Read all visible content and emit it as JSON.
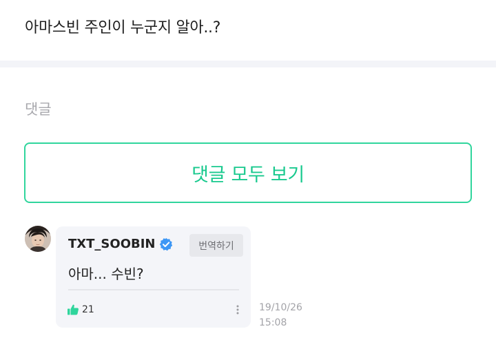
{
  "post": {
    "text": "아마스빈 주인이 누군지 알아..?"
  },
  "comments_section": {
    "heading": "댓글",
    "view_all_label": "댓글 모두 보기"
  },
  "comment": {
    "author": "TXT_SOOBIN",
    "verified_icon": "verified-check-icon",
    "translate_label": "번역하기",
    "text": "아마... 수빈?",
    "like_icon": "thumbs-up-icon",
    "likes": "21",
    "date": "19/10/26",
    "time": "15:08"
  },
  "colors": {
    "accent": "#19c98e",
    "verified": "#3d97f5",
    "bubble": "#f4f5f9"
  }
}
